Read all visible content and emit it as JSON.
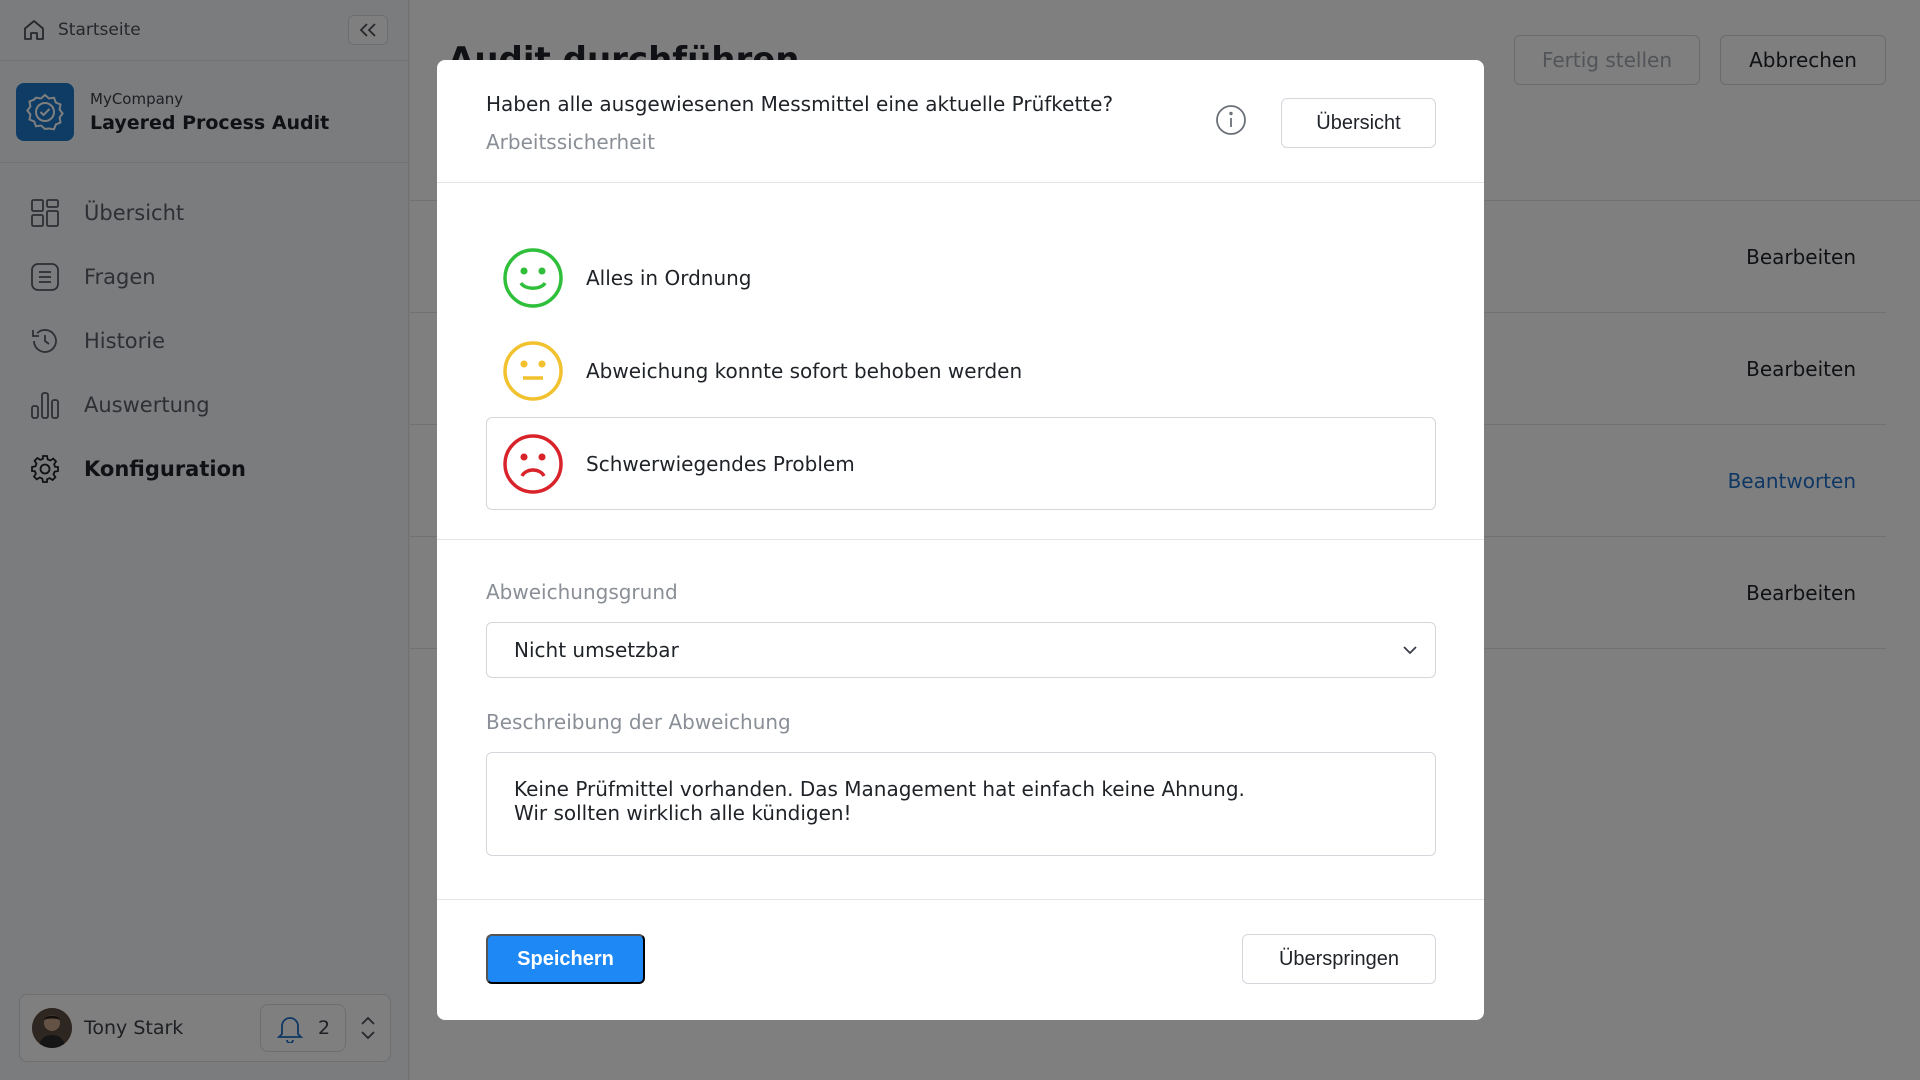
{
  "sidebar": {
    "home_label": "Startseite",
    "company": {
      "name": "MyCompany",
      "app": "Layered Process Audit"
    },
    "nav": [
      {
        "label": "Übersicht",
        "icon": "grid-icon",
        "active": false
      },
      {
        "label": "Fragen",
        "icon": "list-icon",
        "active": false
      },
      {
        "label": "Historie",
        "icon": "history-icon",
        "active": false
      },
      {
        "label": "Auswertung",
        "icon": "bar-chart-icon",
        "active": false
      },
      {
        "label": "Konfiguration",
        "icon": "gear-icon",
        "active": true
      }
    ],
    "user": {
      "name": "Tony Stark",
      "notification_count": "2"
    }
  },
  "main": {
    "title": "Audit durchführen",
    "finish_label": "Fertig stellen",
    "cancel_label": "Abbrechen",
    "rows": [
      {
        "action": "Bearbeiten",
        "primary": false
      },
      {
        "action": "Bearbeiten",
        "primary": false
      },
      {
        "action": "Beantworten",
        "primary": true
      },
      {
        "action": "Bearbeiten",
        "primary": false
      }
    ]
  },
  "modal": {
    "question": "Haben alle ausgewiesenen Messmittel eine aktuelle Prüfkette?",
    "category": "Arbeitssicherheit",
    "overview_label": "Übersicht",
    "options": [
      {
        "label": "Alles in Ordnung",
        "icon": "smiley-happy-icon",
        "color": "#2fbf3a"
      },
      {
        "label": "Abweichung konnte sofort behoben werden",
        "icon": "smiley-neutral-icon",
        "color": "#f2c12e"
      },
      {
        "label": "Schwerwiegendes Problem",
        "icon": "smiley-sad-icon",
        "color": "#d9232a",
        "selected": true
      }
    ],
    "reason_label": "Abweichungsgrund",
    "reason_value": "Nicht umsetzbar",
    "description_label": "Beschreibung der Abweichung",
    "description_lines": [
      "Keine Prüfmittel vorhanden. Das Management hat einfach keine Ahnung.",
      "Wir sollten wirklich alle kündigen!"
    ],
    "save_label": "Speichern",
    "skip_label": "Überspringen"
  },
  "colors": {
    "primary": "#1e88f5",
    "link": "#1f6fc8",
    "brand_logo": "#1f78c8"
  }
}
